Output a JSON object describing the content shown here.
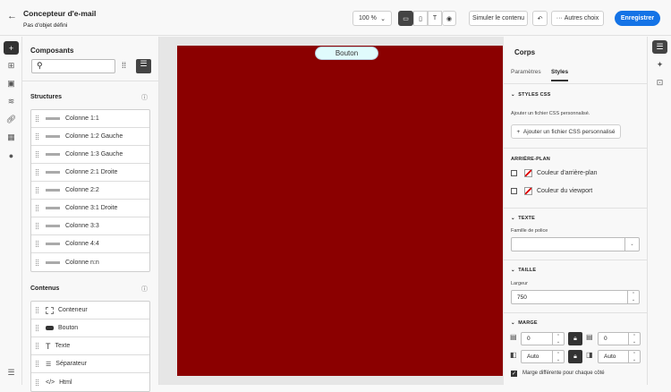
{
  "header": {
    "title": "Concepteur d'e-mail",
    "subtitle": "Pas d'objet défini",
    "zoom": "100 %",
    "simulate": "Simuler le contenu",
    "more": "Autres choix",
    "save": "Enregistrer"
  },
  "left": {
    "title": "Composants",
    "search_placeholder": "",
    "structures_title": "Structures",
    "structures": [
      "Colonne 1:1",
      "Colonne 1:2 Gauche",
      "Colonne 1:3 Gauche",
      "Colonne 2:1 Droite",
      "Colonne 2:2",
      "Colonne 3:1 Droite",
      "Colonne 3:3",
      "Colonne 4:4",
      "Colonne n:n"
    ],
    "contents_title": "Contenus",
    "contents": [
      "Conteneur",
      "Bouton",
      "Texte",
      "Séparateur",
      "Html"
    ]
  },
  "canvas": {
    "button_label": "Bouton",
    "email_bg": "#8b0000"
  },
  "right": {
    "title": "Corps",
    "tabs": [
      "Paramètres",
      "Styles"
    ],
    "css_header": "STYLES CSS",
    "css_desc": "Ajouter un fichier CSS personnalisé.",
    "css_button": "Ajouter un fichier CSS personnalisé",
    "bg_header": "ARRIÈRE-PLAN",
    "bg_color": "Couleur d'arrière-plan",
    "viewport_color": "Couleur du viewport",
    "text_header": "TEXTE",
    "font_family_label": "Famille de police",
    "font_family_value": "",
    "size_header": "TAILLE",
    "width_label": "Largeur",
    "width_value": "750",
    "margin_header": "MARGE",
    "margin_top": "0",
    "margin_bottom": "0",
    "margin_left": "Auto",
    "margin_right": "Auto",
    "margin_diff": "Marge différente pour chaque côté"
  },
  "accent": "#1473e6"
}
